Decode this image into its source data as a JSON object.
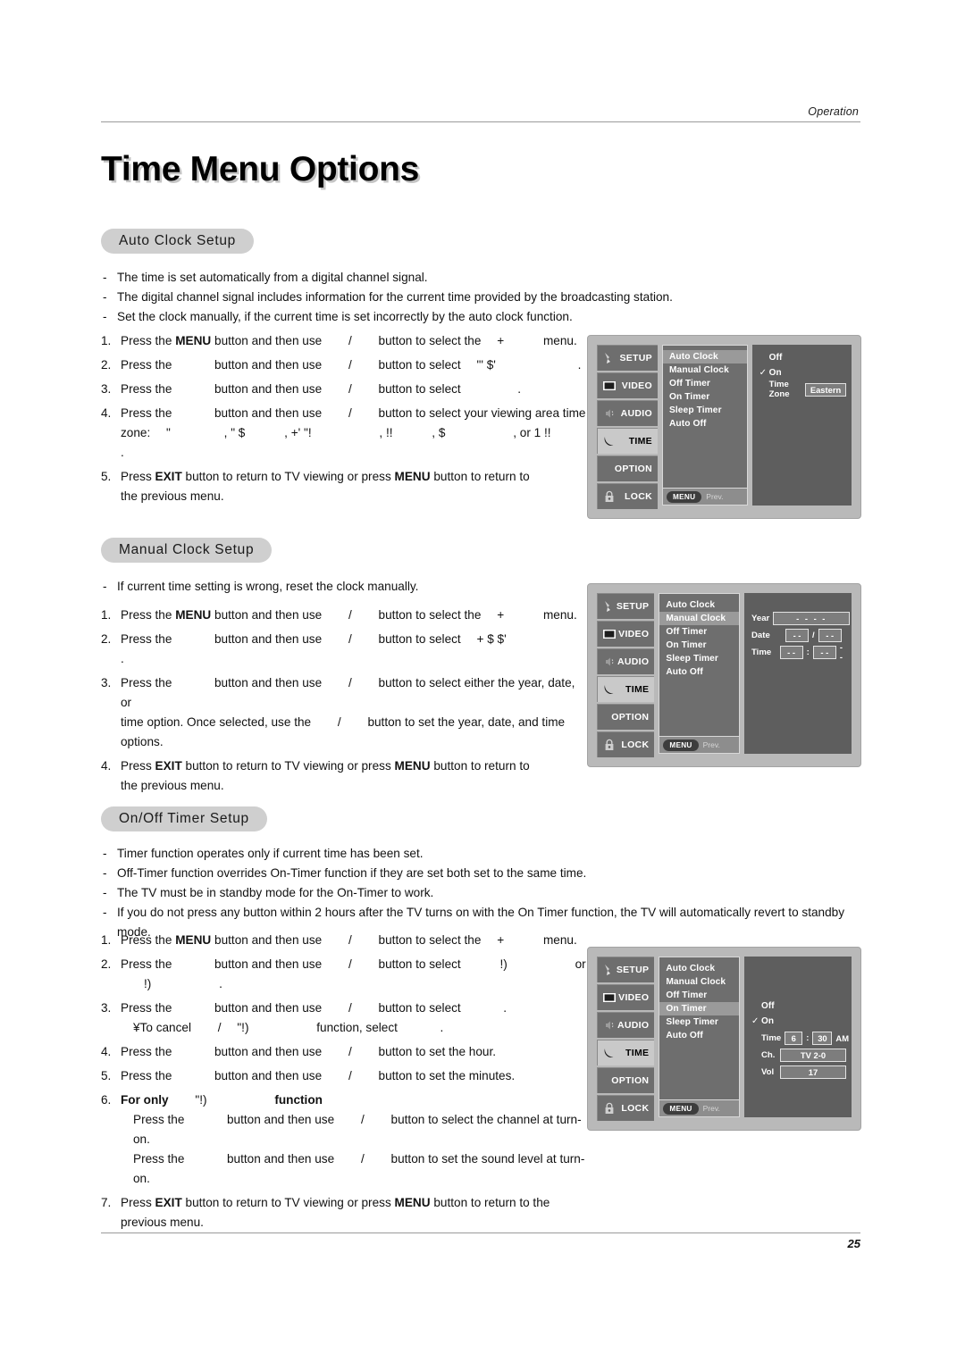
{
  "header": {
    "section_label": "Operation"
  },
  "page_title": "Time Menu Options",
  "footer": {
    "page_number": "25"
  },
  "sections": [
    {
      "pill": "Auto Clock Setup",
      "bullets": [
        "The time is set automatically from a digital channel signal.",
        "The digital channel signal includes information for the current time provided by the broadcasting station.",
        "Set the clock manually, if the current time is set incorrectly by the auto clock function."
      ],
      "steps": {
        "s1_a": "1.",
        "s1_b": "Press the",
        "s1_c": "MENU",
        "s1_d": "button and then use",
        "s1_e": "/",
        "s1_f": "button to select the",
        "s1_g": "+",
        "s1_h": "menu.",
        "s2_a": "2.",
        "s2_b": "Press the",
        "s2_c": "button and then use",
        "s2_d": "/",
        "s2_e": "button to select",
        "s2_f": "\"' $'",
        "s2_g": ".",
        "s3_a": "3.",
        "s3_b": "Press the",
        "s3_c": "button and then use",
        "s3_d": "/",
        "s3_e": "button to select",
        "s3_f": ".",
        "s4_a": "4.",
        "s4_b": "Press the",
        "s4_c": "button and then use",
        "s4_d": "/",
        "s4_e": "button to select your viewing area time",
        "s4_zone_lbl": "zone:",
        "s4_z1": "\"",
        "s4_z2": ", \" $",
        "s4_z3": ", +' \"!",
        "s4_z4": ", !!",
        "s4_z5": ", $",
        "s4_z6": ", or  1 !!",
        "s4_z7": ".",
        "s5_a": "5.",
        "s5_b": "Press",
        "s5_c": "EXIT",
        "s5_d": "button to return to TV viewing or press",
        "s5_e": "MENU",
        "s5_f": "button to return to",
        "s5_g": "the previous menu."
      },
      "osd": {
        "tabs": [
          {
            "label": "SETUP",
            "icon": "antenna-icon",
            "active": false
          },
          {
            "label": "VIDEO",
            "icon": "screen-icon",
            "active": false
          },
          {
            "label": "AUDIO",
            "icon": "sound-icon",
            "active": false
          },
          {
            "label": "TIME",
            "icon": "moon-icon",
            "active": true
          },
          {
            "label": "OPTION",
            "icon": "none",
            "active": false
          },
          {
            "label": "LOCK",
            "icon": "padlock-icon",
            "active": false
          }
        ],
        "items": [
          {
            "label": "Auto Clock",
            "selected": true
          },
          {
            "label": "Manual Clock",
            "selected": false
          },
          {
            "label": "Off Timer",
            "selected": false
          },
          {
            "label": "On Timer",
            "selected": false
          },
          {
            "label": "Sleep Timer",
            "selected": false
          },
          {
            "label": "Auto Off",
            "selected": false
          }
        ],
        "menu_chip": "MENU",
        "prev_label": "Prev.",
        "right": {
          "off_label": "Off",
          "on_label": "On",
          "on_check": "✓",
          "timezone_label": "Time Zone",
          "timezone_value": "Eastern"
        }
      }
    },
    {
      "pill": "Manual Clock Setup",
      "bullets": [
        "If current time setting is wrong, reset the clock manually."
      ],
      "steps": {
        "s1_a": "1.",
        "s1_b": "Press the",
        "s1_c": "MENU",
        "s1_d": "button and then use",
        "s1_e": "/",
        "s1_f": "button to select the",
        "s1_g": "+",
        "s1_h": "menu.",
        "s2_a": "2.",
        "s2_b": "Press the",
        "s2_c": "button and then use",
        "s2_d": "/",
        "s2_e": "button to select",
        "s2_f": "+  $ $'",
        "s2_g": ".",
        "s3_a": "3.",
        "s3_b": "Press the",
        "s3_c": "button and then use",
        "s3_d": "/",
        "s3_e": "button to select either the year, date, or",
        "s3_f": "time option. Once selected, use the",
        "s3_g": "/",
        "s3_h": "button to set the year, date, and time",
        "s3_i": "options.",
        "s4_a": "4.",
        "s4_b": "Press",
        "s4_c": "EXIT",
        "s4_d": "button to return to TV viewing or press",
        "s4_e": "MENU",
        "s4_f": "button to return to",
        "s4_g": "the previous menu."
      },
      "osd": {
        "tabs": [
          {
            "label": "SETUP",
            "icon": "antenna-icon",
            "active": false
          },
          {
            "label": "VIDEO",
            "icon": "screen-icon",
            "active": false
          },
          {
            "label": "AUDIO",
            "icon": "sound-icon",
            "active": false
          },
          {
            "label": "TIME",
            "icon": "moon-icon",
            "active": true
          },
          {
            "label": "OPTION",
            "icon": "none",
            "active": false
          },
          {
            "label": "LOCK",
            "icon": "padlock-icon",
            "active": false
          }
        ],
        "items": [
          {
            "label": "Auto Clock",
            "selected": false
          },
          {
            "label": "Manual Clock",
            "selected": true
          },
          {
            "label": "Off Timer",
            "selected": false
          },
          {
            "label": "On Timer",
            "selected": false
          },
          {
            "label": "Sleep Timer",
            "selected": false
          },
          {
            "label": "Auto Off",
            "selected": false
          }
        ],
        "menu_chip": "MENU",
        "prev_label": "Prev.",
        "right": {
          "year_label": "Year",
          "year_value": "- - - -",
          "date_label": "Date",
          "date_month": "- -",
          "date_sep": "/",
          "date_day": "- -",
          "time_label": "Time",
          "time_hour": "- -",
          "time_sep": ":",
          "time_min": "- -",
          "time_ampm": "- -"
        }
      }
    },
    {
      "pill": "On/Off Timer Setup",
      "bullets": [
        "Timer function operates only if current time has been set.",
        "Off-Timer function overrides On-Timer function if they are set both set to the same time.",
        "The TV must be in standby mode for the On-Timer to work.",
        "If you do not press any button within 2 hours after the TV turns on with the On Timer function, the TV will automatically revert to standby mode."
      ],
      "steps": {
        "s1_a": "1.",
        "s1_b": "Press the",
        "s1_c": "MENU",
        "s1_d": "button and then use",
        "s1_e": "/",
        "s1_f": "button to select the",
        "s1_g": "+",
        "s1_h": "menu.",
        "s2_a": "2.",
        "s2_b": "Press the",
        "s2_c": "button and then use",
        "s2_d": "/",
        "s2_e": "button to select",
        "s2_f": "!)",
        "s2_g": "or",
        "s2_h": "!)",
        "s2_i": ".",
        "s3_a": "3.",
        "s3_b": "Press the",
        "s3_c": "button and then use",
        "s3_d": "/",
        "s3_e": "button to select",
        "s3_f": ".",
        "s3_note_a": "¥To cancel",
        "s3_note_b": "/",
        "s3_note_c": "\"!)",
        "s3_note_d": "function, select",
        "s3_note_e": ".",
        "s4_a": "4.",
        "s4_b": "Press the",
        "s4_c": "button and then use",
        "s4_d": "/",
        "s4_e": "button to set the hour.",
        "s5_a": "5.",
        "s5_b": "Press the",
        "s5_c": "button and then use",
        "s5_d": "/",
        "s5_e": "button to set the minutes.",
        "s6_a": "6.",
        "s6_b": "For only",
        "s6_c": "\"!)",
        "s6_d": "function",
        "s6_l1_a": "Press the",
        "s6_l1_b": "button and then use",
        "s6_l1_c": "/",
        "s6_l1_d": "button to select the channel at turn-on.",
        "s6_l2_a": "Press the",
        "s6_l2_b": "button and then use",
        "s6_l2_c": "/",
        "s6_l2_d": "button to set the sound level at turn-on.",
        "s7_a": "7.",
        "s7_b": "Press",
        "s7_c": "EXIT",
        "s7_d": "button to return to TV viewing or press",
        "s7_e": "MENU",
        "s7_f": "button to return to the",
        "s7_g": "previous menu."
      },
      "osd": {
        "tabs": [
          {
            "label": "SETUP",
            "icon": "antenna-icon",
            "active": false
          },
          {
            "label": "VIDEO",
            "icon": "screen-icon",
            "active": false
          },
          {
            "label": "AUDIO",
            "icon": "sound-icon",
            "active": false
          },
          {
            "label": "TIME",
            "icon": "moon-icon",
            "active": true
          },
          {
            "label": "OPTION",
            "icon": "none",
            "active": false
          },
          {
            "label": "LOCK",
            "icon": "padlock-icon",
            "active": false
          }
        ],
        "items": [
          {
            "label": "Auto Clock",
            "selected": false
          },
          {
            "label": "Manual Clock",
            "selected": false
          },
          {
            "label": "Off Timer",
            "selected": false
          },
          {
            "label": "On Timer",
            "selected": true
          },
          {
            "label": "Sleep Timer",
            "selected": false
          },
          {
            "label": "Auto Off",
            "selected": false
          }
        ],
        "menu_chip": "MENU",
        "prev_label": "Prev.",
        "right": {
          "off_label": "Off",
          "on_label": "On",
          "on_check": "✓",
          "time_label": "Time",
          "time_hour": "6",
          "time_sep": ":",
          "time_min": "30",
          "time_ampm": "AM",
          "ch_label": "Ch.",
          "ch_value": "TV  2-0",
          "vol_label": "Vol",
          "vol_value": "17"
        }
      }
    }
  ],
  "colors": {
    "pill_bg": "#cfcfcf",
    "osd_frame": "#b9b9b9",
    "osd_tab": "#6e6e6e",
    "osd_tab_active": "#c9c9c9",
    "osd_right": "#5e5e5e",
    "rule": "#9a9a9a"
  }
}
